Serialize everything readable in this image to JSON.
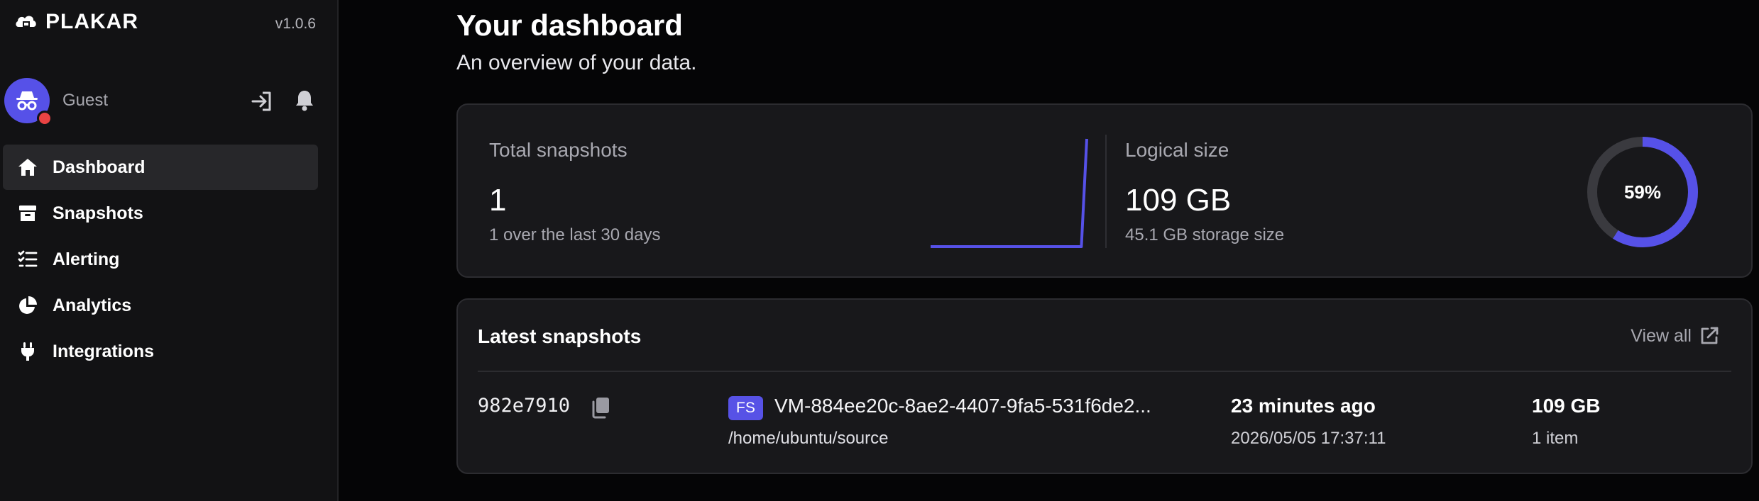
{
  "brand": {
    "name": "PLAKAR",
    "version": "v1.0.6"
  },
  "user": {
    "name": "Guest"
  },
  "nav": [
    {
      "label": "Dashboard",
      "icon": "home-icon",
      "active": true
    },
    {
      "label": "Snapshots",
      "icon": "archive-icon",
      "active": false
    },
    {
      "label": "Alerting",
      "icon": "checklist-icon",
      "active": false
    },
    {
      "label": "Analytics",
      "icon": "pie-chart-icon",
      "active": false
    },
    {
      "label": "Integrations",
      "icon": "plug-icon",
      "active": false
    }
  ],
  "header": {
    "title": "Your dashboard",
    "subtitle": "An overview of your data."
  },
  "stats": {
    "total_snapshots": {
      "label": "Total snapshots",
      "value": "1",
      "sub": "1 over the last 30 days"
    },
    "logical_size": {
      "label": "Logical size",
      "value": "109 GB",
      "sub": "45.1 GB storage size"
    },
    "storage_ratio": {
      "label": "59%",
      "fraction": 0.59
    }
  },
  "chart_data": {
    "type": "line",
    "series": [
      {
        "values": [
          0,
          0,
          0,
          0,
          0,
          0,
          0,
          0,
          0,
          0,
          0,
          0,
          0,
          0,
          0,
          0,
          0,
          0,
          0,
          0,
          0,
          0,
          0,
          0,
          0,
          0,
          0,
          0,
          0,
          1
        ]
      }
    ]
  },
  "latest": {
    "title": "Latest snapshots",
    "view_all": "View all",
    "rows": [
      {
        "id": "982e7910",
        "badge": "FS",
        "name": "VM-884ee20c-8ae2-4407-9fa5-531f6de2...",
        "path": "/home/ubuntu/source",
        "ago": "23 minutes ago",
        "date": "2026/05/05 17:37:11",
        "size": "109 GB",
        "items": "1 item"
      }
    ]
  },
  "colors": {
    "accent": "#5651e8",
    "alert": "#e94343",
    "track": "#3a3a3f"
  }
}
